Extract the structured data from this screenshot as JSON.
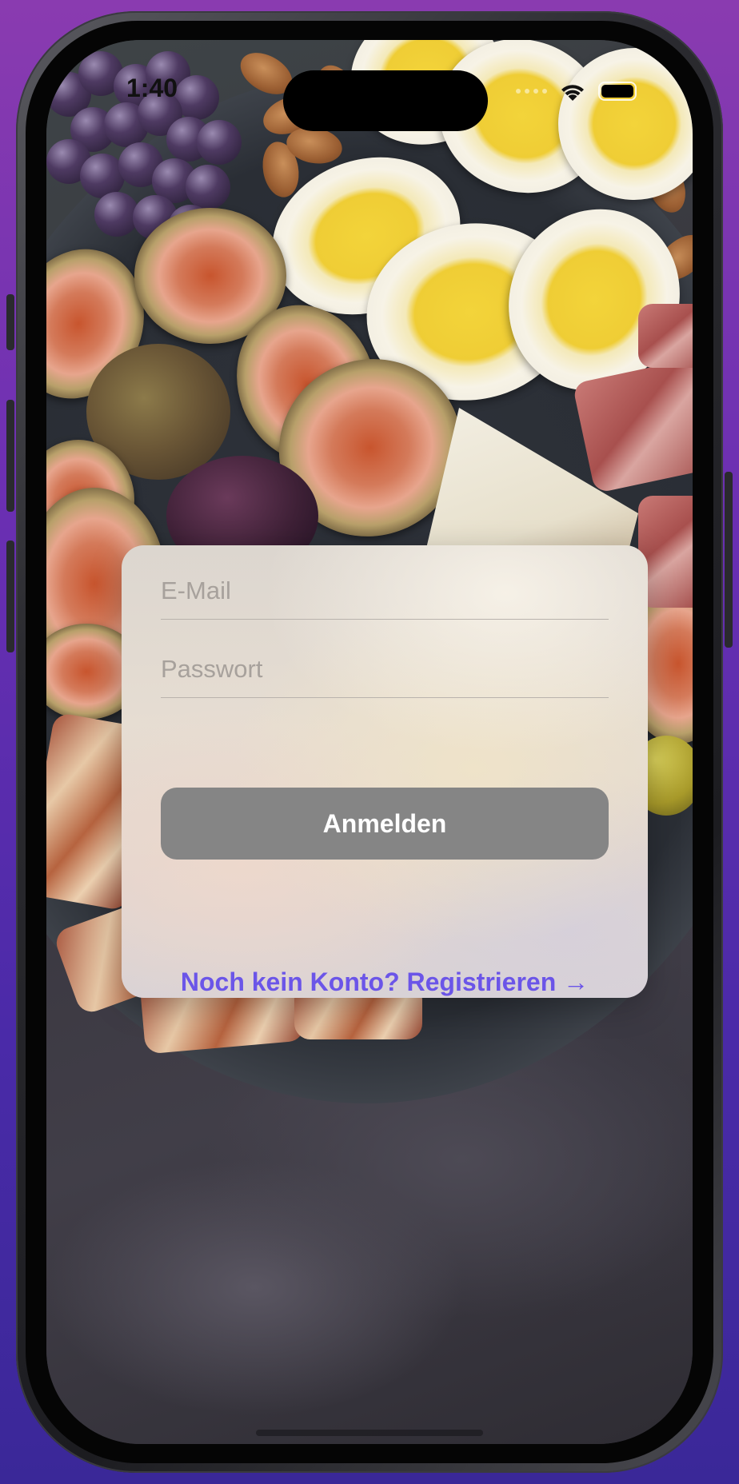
{
  "status_bar": {
    "time": "1:40"
  },
  "login": {
    "email_placeholder": "E-Mail",
    "password_placeholder": "Passwort",
    "submit_label": "Anmelden",
    "register_link": "Noch kein Konto? Registrieren →"
  },
  "colors": {
    "accent": "#6b55e8",
    "button_bg": "#858585",
    "button_text": "#ffffff"
  }
}
